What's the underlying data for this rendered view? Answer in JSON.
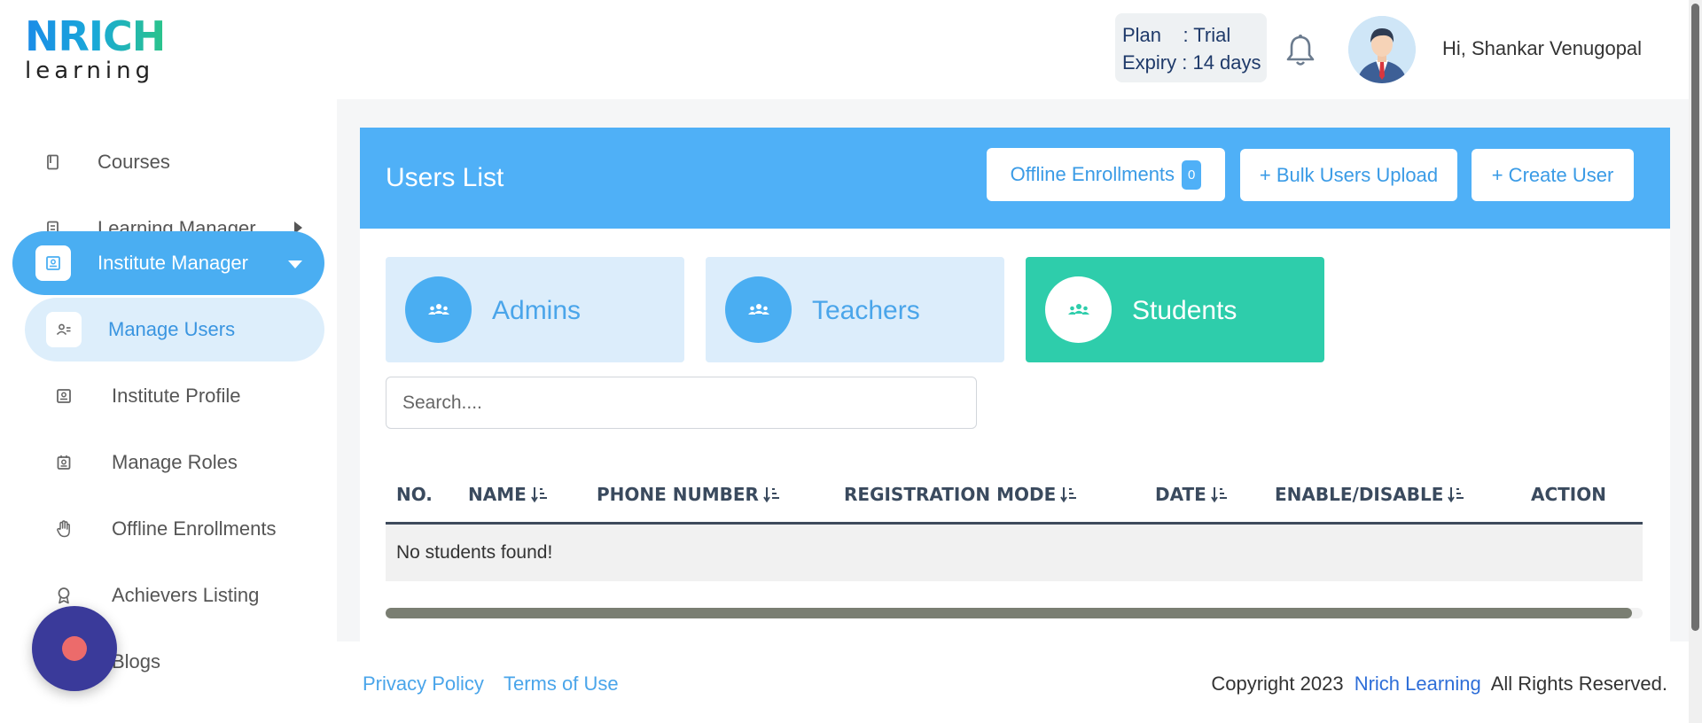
{
  "header": {
    "logo_main": "NRICH",
    "logo_sub": "learning",
    "plan_label": "Plan    : Trial",
    "expiry_label": "Expiry : 14 days",
    "greeting": "Hi, Shankar Venugopal"
  },
  "sidebar": {
    "items": [
      {
        "label": "Courses",
        "icon": "book-icon"
      },
      {
        "label": "Learning Manager",
        "icon": "document-icon"
      },
      {
        "label": "Institute Manager",
        "icon": "id-card-icon"
      },
      {
        "label": "Manage Users",
        "icon": "users-icon"
      },
      {
        "label": "Institute Profile",
        "icon": "profile-icon"
      },
      {
        "label": "Manage Roles",
        "icon": "badge-icon"
      },
      {
        "label": "Offline Enrollments",
        "icon": "hand-icon"
      },
      {
        "label": "Achievers Listing",
        "icon": "award-icon"
      },
      {
        "label": "Blogs",
        "icon": "blog-icon"
      }
    ]
  },
  "main": {
    "title": "Users List",
    "buttons": {
      "offline_enrollments": "Offline Enrollments",
      "offline_count": "0",
      "bulk_upload": "+ Bulk Users Upload",
      "create_user": "+ Create User"
    },
    "roles": [
      "Admins",
      "Teachers",
      "Students"
    ],
    "active_role": "Students",
    "search_placeholder": "Search....",
    "table": {
      "columns": [
        "NO.",
        "NAME",
        "PHONE NUMBER",
        "REGISTRATION MODE",
        "DATE",
        "ENABLE/DISABLE",
        "ACTION"
      ],
      "empty_message": "No students found!"
    }
  },
  "footer": {
    "privacy": "Privacy Policy",
    "terms": "Terms of Use",
    "copyright": "Copyright 2023",
    "brand": "Nrich Learning",
    "rights": "All Rights Reserved."
  },
  "colors": {
    "primary": "#4fb0f7",
    "students_active": "#2ecdab",
    "role_inactive": "#dcedfb",
    "fab": "#3a3a9a"
  }
}
